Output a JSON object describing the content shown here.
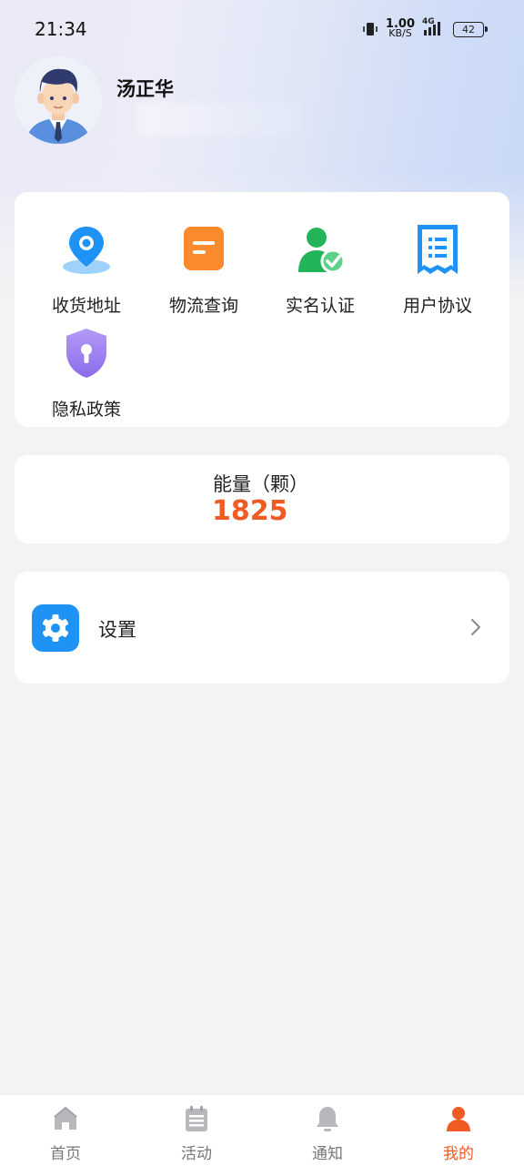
{
  "status_bar": {
    "time": "21:34",
    "net_speed": "1.00",
    "net_unit": "KB/S",
    "signal": "4G",
    "battery": "42"
  },
  "profile": {
    "name": "汤正华"
  },
  "menu": {
    "items": [
      {
        "label": "收货地址",
        "icon": "location-pin-icon"
      },
      {
        "label": "物流查询",
        "icon": "logistics-doc-icon"
      },
      {
        "label": "实名认证",
        "icon": "verified-user-icon"
      },
      {
        "label": "用户协议",
        "icon": "agreement-doc-icon"
      },
      {
        "label": "隐私政策",
        "icon": "privacy-shield-icon"
      }
    ]
  },
  "energy": {
    "label": "能量（颗）",
    "value": "1825"
  },
  "settings": {
    "label": "设置"
  },
  "tabbar": {
    "tabs": [
      {
        "label": "首页",
        "icon": "home-icon"
      },
      {
        "label": "活动",
        "icon": "activity-list-icon"
      },
      {
        "label": "通知",
        "icon": "bell-icon"
      },
      {
        "label": "我的",
        "icon": "user-icon",
        "active": true
      }
    ]
  },
  "colors": {
    "accent": "#f05a23",
    "blue": "#1f93f5",
    "orange": "#fa8a2b",
    "green": "#23b45a",
    "purple": "#9a7cf0"
  }
}
